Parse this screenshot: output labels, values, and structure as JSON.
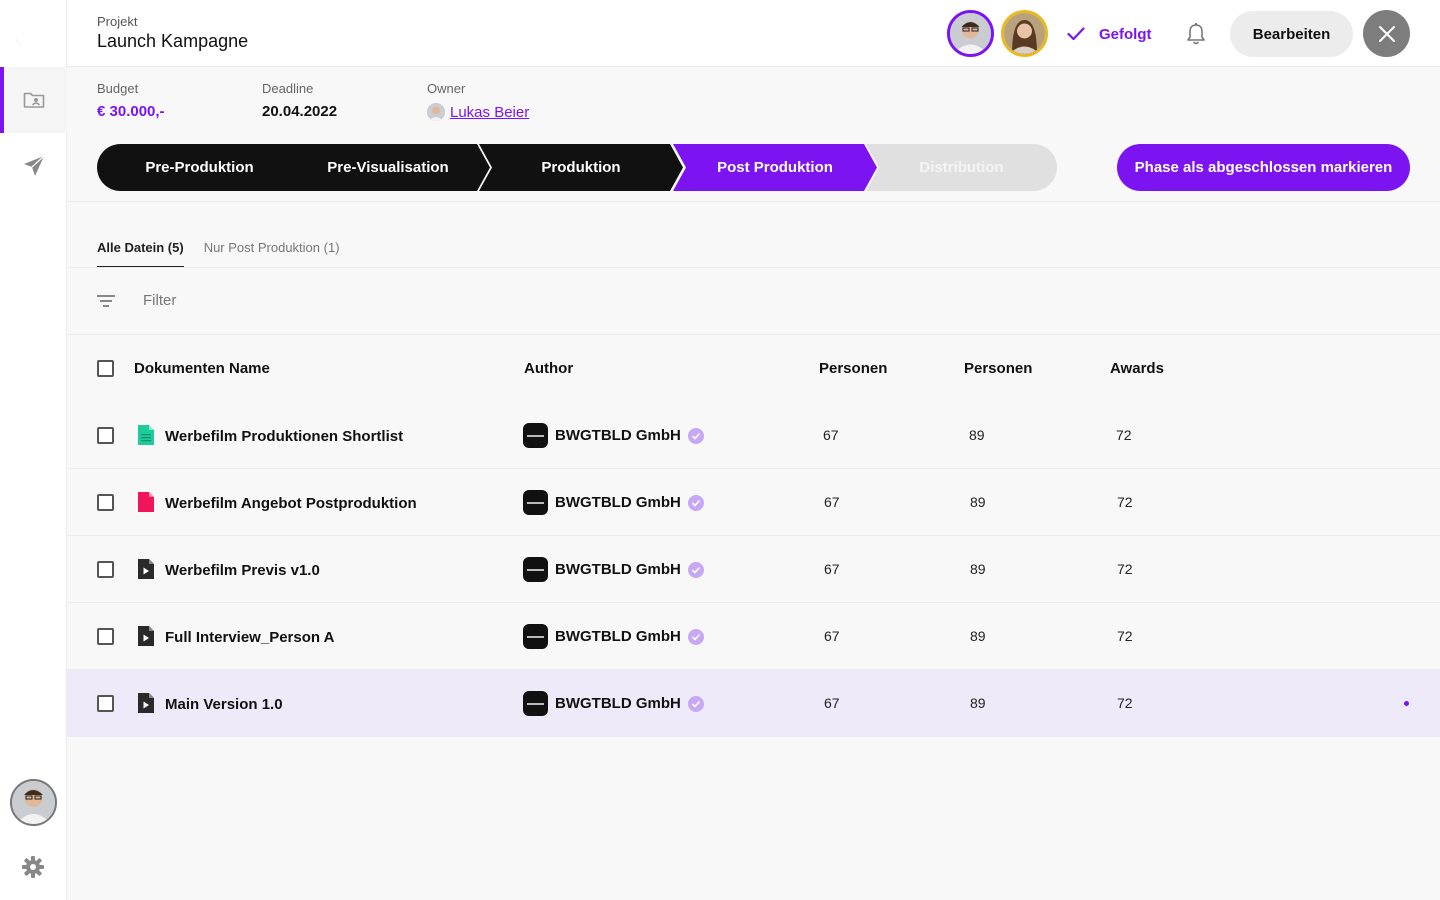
{
  "header": {
    "project_label": "Projekt",
    "project_title": "Launch Kampagne",
    "followed_label": "Gefolgt",
    "edit_label": "Bearbeiten"
  },
  "meta": {
    "budget_label": "Budget",
    "budget_value": "€ 30.000,-",
    "deadline_label": "Deadline",
    "deadline_value": "20.04.2022",
    "owner_label": "Owner",
    "owner_name": "Lukas Beier"
  },
  "phases": [
    {
      "label": "Pre-Produktion",
      "state": "done"
    },
    {
      "label": "Pre-Visualisation",
      "state": "done"
    },
    {
      "label": "Produktion",
      "state": "done"
    },
    {
      "label": "Post Produktion",
      "state": "active"
    },
    {
      "label": "Distribution",
      "state": "upcoming"
    }
  ],
  "complete_button": "Phase als abgeschlossen markieren",
  "tabs": [
    {
      "label": "Alle Datein (5)",
      "active": true
    },
    {
      "label": "Nur Post Produktion (1)",
      "active": false
    }
  ],
  "filter_label": "Filter",
  "table": {
    "columns": [
      "Dokumenten Name",
      "Author",
      "Personen",
      "Personen",
      "Awards"
    ],
    "rows": [
      {
        "name": "Werbefilm Produktionen Shortlist",
        "icon": "spreadsheet-file-icon",
        "icon_color": "#1ecb9a",
        "author": "BWGTBLD GmbH",
        "p1": "67",
        "p2": "89",
        "awards": "72"
      },
      {
        "name": "Werbefilm Angebot Postproduktion",
        "icon": "pdf-file-icon",
        "icon_color": "#f0145a",
        "author": "BWGTBLD GmbH",
        "p1": "67",
        "p2": "89",
        "awards": "72"
      },
      {
        "name": "Werbefilm Previs v1.0",
        "icon": "video-file-icon",
        "icon_color": "#2a2a2a",
        "author": "BWGTBLD GmbH",
        "p1": "67",
        "p2": "89",
        "awards": "72"
      },
      {
        "name": "Full Interview_Person A",
        "icon": "video-file-icon",
        "icon_color": "#2a2a2a",
        "author": "BWGTBLD GmbH",
        "p1": "67",
        "p2": "89",
        "awards": "72"
      },
      {
        "name": "Main Version 1.0",
        "icon": "video-file-icon",
        "icon_color": "#2a2a2a",
        "author": "BWGTBLD GmbH",
        "p1": "67",
        "p2": "89",
        "awards": "72"
      }
    ]
  },
  "colors": {
    "accent": "#7b14f0",
    "phase_done": "#111111",
    "phase_upcoming": "#e0e0e0",
    "highlight_row": "#efeaf9"
  }
}
